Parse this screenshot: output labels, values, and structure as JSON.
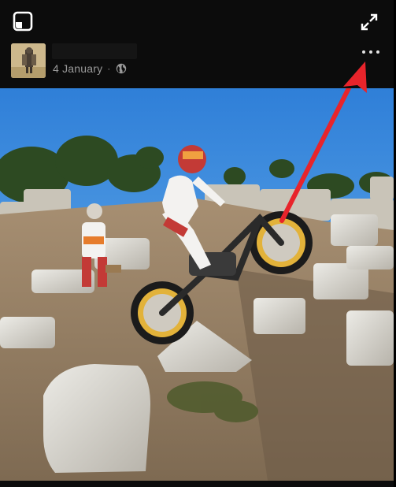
{
  "post": {
    "date": "4 January",
    "separator": "·",
    "privacy_icon": "globe-icon"
  },
  "icons": {
    "pip": "picture-in-picture-icon",
    "expand": "expand-icon",
    "more": "more-options-icon"
  },
  "annotation": {
    "arrow_color": "#e8242b",
    "points_to": "more-options-button"
  },
  "colors": {
    "background": "#0c0c0c",
    "meta_text": "#9a9a9a",
    "icon": "#ffffff"
  }
}
